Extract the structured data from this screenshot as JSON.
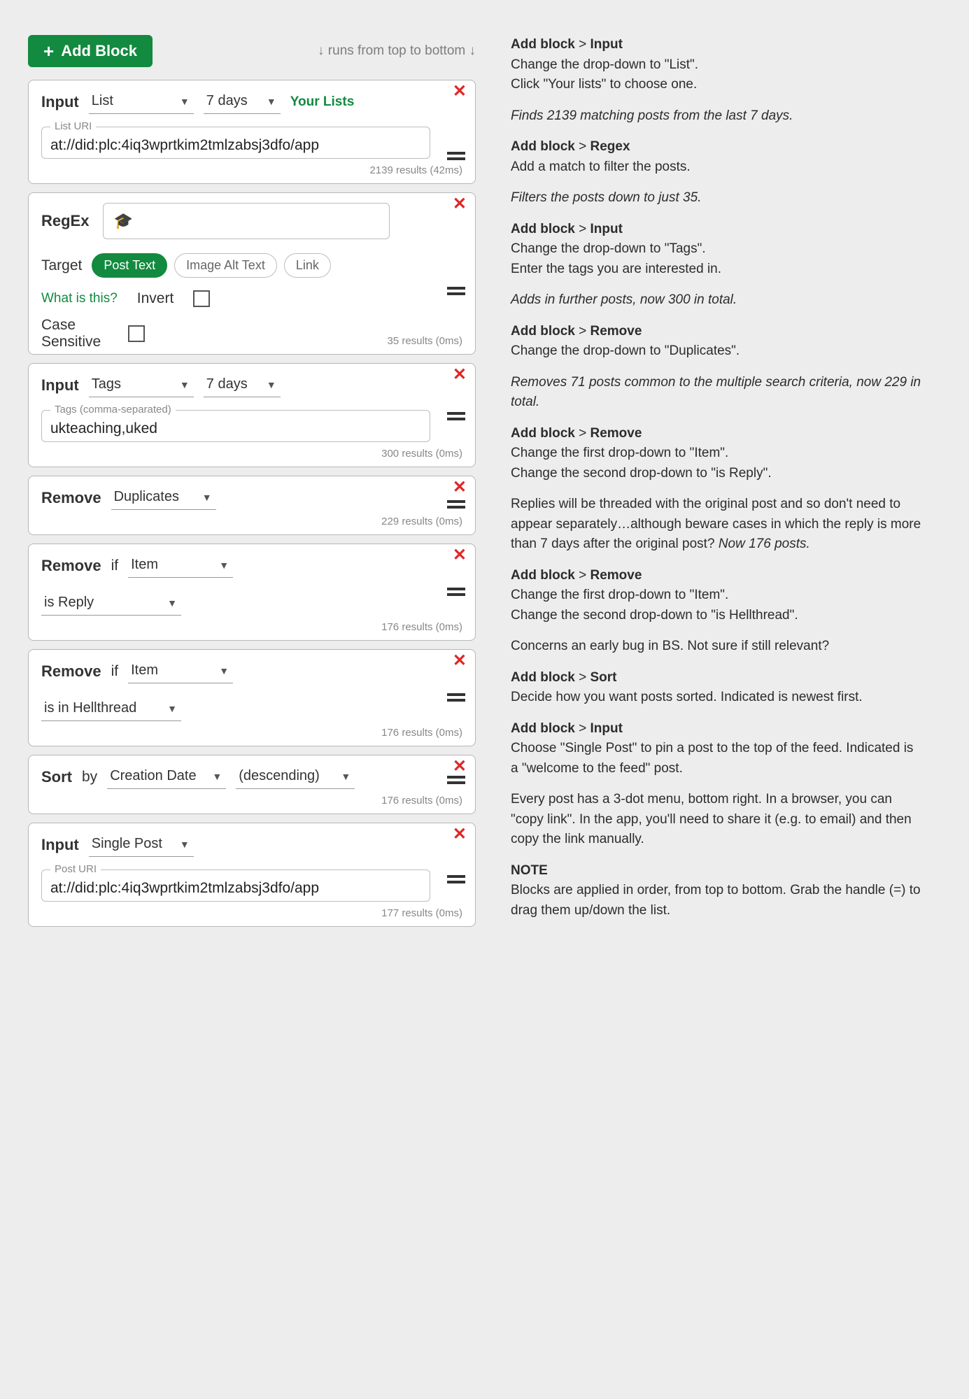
{
  "topbar": {
    "add_label": "Add Block",
    "runs_hint": "↓ runs from top to bottom ↓"
  },
  "blocks": {
    "b1": {
      "title": "Input",
      "type_sel": "List",
      "duration_sel": "7 days",
      "your_lists": "Your Lists",
      "field_label": "List URI",
      "field_value": "at://did:plc:4iq3wprtkim2tmlzabsj3dfo/app",
      "results": "2139 results (42ms)"
    },
    "b2": {
      "title": "RegEx",
      "input_value": "🎓",
      "target_label": "Target",
      "chip1": "Post Text",
      "chip2": "Image Alt Text",
      "chip3": "Link",
      "what": "What is this?",
      "invert": "Invert",
      "case": "Case Sensitive",
      "results": "35 results (0ms)"
    },
    "b3": {
      "title": "Input",
      "type_sel": "Tags",
      "duration_sel": "7 days",
      "field_label": "Tags (comma-separated)",
      "field_value": "ukteaching,uked",
      "results": "300 results (0ms)"
    },
    "b4": {
      "title": "Remove",
      "sel1": "Duplicates",
      "results": "229 results (0ms)"
    },
    "b5": {
      "title": "Remove",
      "if": "if",
      "sel1": "Item",
      "sel2": "is Reply",
      "results": "176 results (0ms)"
    },
    "b6": {
      "title": "Remove",
      "if": "if",
      "sel1": "Item",
      "sel2": "is in Hellthread",
      "results": "176 results (0ms)"
    },
    "b7": {
      "title": "Sort",
      "by": "by",
      "sel1": "Creation Date",
      "sel2": "(descending)",
      "results": "176 results (0ms)"
    },
    "b8": {
      "title": "Input",
      "type_sel": "Single Post",
      "field_label": "Post URI",
      "field_value": "at://did:plc:4iq3wprtkim2tmlzabsj3dfo/app",
      "results": "177 results (0ms)"
    }
  },
  "instructions": {
    "ab": "Add block",
    "gt": " > ",
    "s1": {
      "h": "Input",
      "p1": "Change the drop-down to \"List\".",
      "p2": "Click \"Your lists\" to choose one.",
      "note": "Finds 2139 matching posts from the last 7 days."
    },
    "s2": {
      "h": "Regex",
      "p1": "Add a match to filter the posts.",
      "note": "Filters the posts down to just 35."
    },
    "s3": {
      "h": "Input",
      "p1": "Change the drop-down to \"Tags\".",
      "p2": "Enter the tags you are interested in.",
      "note": "Adds in further posts, now 300 in total."
    },
    "s4": {
      "h": "Remove",
      "p1": "Change the drop-down to \"Duplicates\".",
      "note": "Removes 71 posts common to the multiple search criteria, now 229 in total."
    },
    "s5": {
      "h": "Remove",
      "p1": "Change the first drop-down to \"Item\".",
      "p2": "Change the second drop-down to \"is Reply\".",
      "note_a": "Replies will be threaded with the original post and so don't need to appear separately…although beware cases in which the reply is more than 7 days after the original post?",
      "note_b": "Now 176 posts."
    },
    "s6": {
      "h": "Remove",
      "p1": "Change the first drop-down to \"Item\".",
      "p2": "Change the second drop-down to \"is Hellthread\".",
      "note": "Concerns an early bug in BS.  Not sure if still relevant?"
    },
    "s7": {
      "h": "Sort",
      "p1": "Decide how you want posts sorted.  Indicated is newest first."
    },
    "s8": {
      "h": "Input",
      "p1": "Choose \"Single Post\" to pin a post to the top of the feed.  Indicated is a \"welcome to the feed\" post.",
      "p2": "Every post has a 3-dot menu, bottom right.  In a browser, you can \"copy link\".  In the app, you'll need to share it (e.g. to email) and then copy the link manually."
    },
    "note": {
      "h": "NOTE",
      "p": "Blocks are applied in order, from top to bottom.  Grab the handle (=) to drag them up/down the list."
    }
  }
}
